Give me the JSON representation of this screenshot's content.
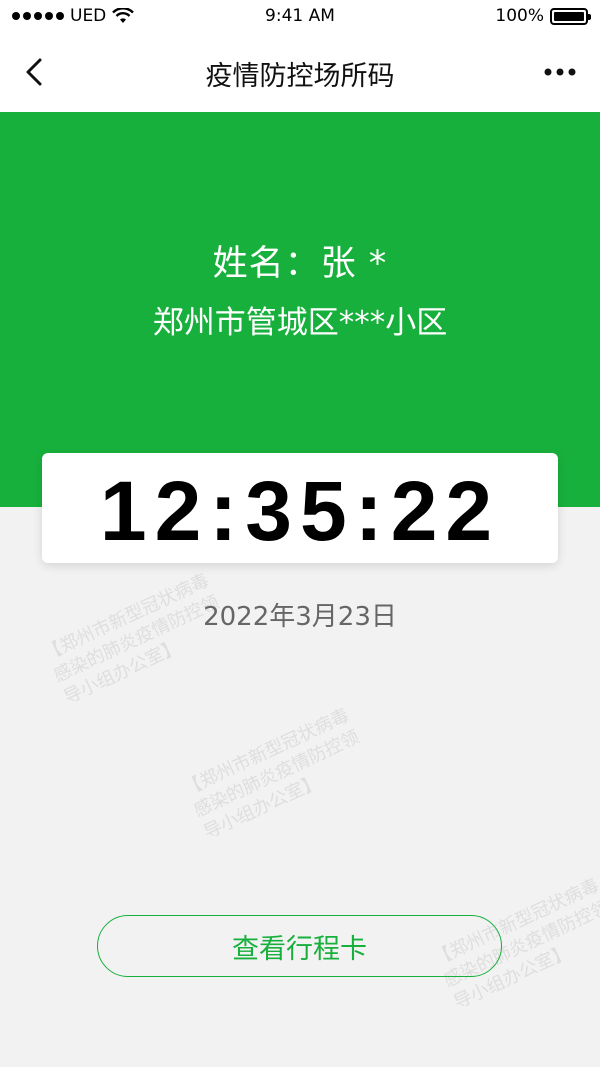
{
  "status_bar": {
    "carrier": "UED",
    "time": "9:41 AM",
    "battery": "100%"
  },
  "nav": {
    "title": "疫情防控场所码",
    "back_icon": "chevron-left-icon",
    "more_icon": "more-horizontal-icon"
  },
  "card": {
    "name_line": "姓名：张 *",
    "address": "郑州市管城区***小区",
    "time": "12:35:22",
    "date": "2022年3月23日"
  },
  "watermark": {
    "line1": "【郑州市新型冠状病毒",
    "line2": "感染的肺炎疫情防控领",
    "line3": "导小组办公室】"
  },
  "actions": {
    "trip_card_label": "查看行程卡"
  },
  "colors": {
    "brand_green": "#18b03c",
    "background": "#f2f2f2"
  }
}
